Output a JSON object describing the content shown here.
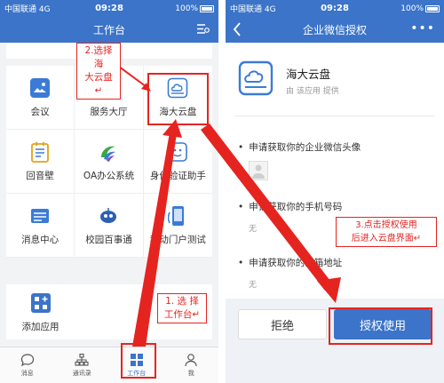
{
  "left_phone": {
    "status": {
      "carrier": "中国联通 4G",
      "time": "09:28",
      "battery": "100%"
    },
    "title": "工作台",
    "apps": [
      {
        "label": "会议"
      },
      {
        "label": "服务大厅"
      },
      {
        "label": "海大云盘"
      },
      {
        "label": "回音壁"
      },
      {
        "label": "OA办公系统"
      },
      {
        "label": "身份验证助手"
      },
      {
        "label": "消息中心"
      },
      {
        "label": "校园百事通"
      },
      {
        "label": "移动门户测试"
      }
    ],
    "add_app": "添加应用",
    "tabs": [
      {
        "label": "消息"
      },
      {
        "label": "通讯录"
      },
      {
        "label": "工作台"
      },
      {
        "label": "我"
      }
    ]
  },
  "right_phone": {
    "status": {
      "carrier": "中国联通 4G",
      "time": "09:28",
      "battery": "100%"
    },
    "title": "企业微信授权",
    "app_name": "海大云盘",
    "provider": "由 该应用 提供",
    "permissions": [
      {
        "title": "申请获取你的企业微信头像",
        "value": ""
      },
      {
        "title": "申请获取你的手机号码",
        "value": "无"
      },
      {
        "title": "申请获取你的邮箱地址",
        "value": "无"
      }
    ],
    "reject_label": "拒绝",
    "authorize_label": "授权使用"
  },
  "annotations": {
    "step1": "1. 选 择\n工作台↵",
    "step2": "2.选择海\n大云盘↵",
    "step3": "3.点击授权使用\n后进入云盘界面↵"
  },
  "colors": {
    "brand_blue": "#3b74c9",
    "annotation_red": "#e52420"
  }
}
